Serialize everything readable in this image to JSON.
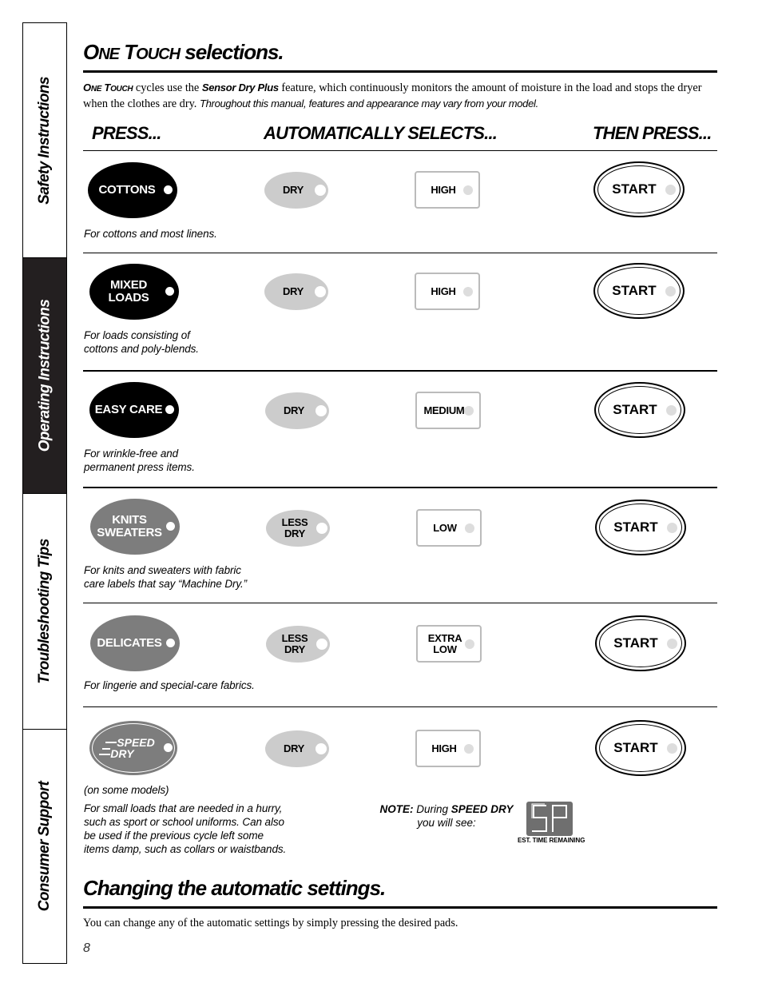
{
  "side_tabs": [
    {
      "label": "Safety Instructions",
      "active": false
    },
    {
      "label": "Operating Instructions",
      "active": true
    },
    {
      "label": "Troubleshooting Tips",
      "active": false
    },
    {
      "label": "Consumer Support",
      "active": false
    }
  ],
  "section1": {
    "title_first": "O",
    "title_first_small": "NE",
    "title_second": " T",
    "title_second_small": "OUCH",
    "title_rest": " selections.",
    "intro": {
      "brand_first": "O",
      "brand_first_small": "NE",
      "brand_second": " T",
      "brand_second_small": "OUCH",
      "text1": " cycles use the ",
      "feature": "Sensor Dry Plus",
      "text2": " feature, which continuously monitors the amount of moisture in the load and stops the dryer when the clothes are dry. ",
      "disclaimer": "Throughout this manual, features and appearance may vary from your model."
    }
  },
  "columns": {
    "press": "PRESS...",
    "auto_selects": "AUTOMATICALLY SELECTS...",
    "then_press": "THEN PRESS..."
  },
  "cycles": [
    {
      "cycle_line1": "COTTONS",
      "cycle_line2": "",
      "cycle_style": "black",
      "dryness": "DRY",
      "dryness_line2": "",
      "heat": "HIGH",
      "heat_line2": "",
      "start": "START",
      "description": [
        "For cottons and most linens."
      ]
    },
    {
      "cycle_line1": "MIXED",
      "cycle_line2": "LOADS",
      "cycle_style": "black",
      "dryness": "DRY",
      "dryness_line2": "",
      "heat": "HIGH",
      "heat_line2": "",
      "start": "START",
      "description": [
        "For loads consisting of",
        "cottons and poly-blends."
      ]
    },
    {
      "cycle_line1": "EASY CARE",
      "cycle_line2": "",
      "cycle_style": "black",
      "dryness": "DRY",
      "dryness_line2": "",
      "heat": "MEDIUM",
      "heat_line2": "",
      "start": "START",
      "description": [
        "For wrinkle-free and",
        "permanent press items."
      ]
    },
    {
      "cycle_line1": "KNITS",
      "cycle_line2": "SWEATERS",
      "cycle_style": "grey",
      "dryness": "LESS",
      "dryness_line2": "DRY",
      "heat": "LOW",
      "heat_line2": "",
      "start": "START",
      "description": [
        "For knits and sweaters with fabric",
        "care labels that say “Machine Dry.”"
      ]
    },
    {
      "cycle_line1": "DELICATES",
      "cycle_line2": "",
      "cycle_style": "grey",
      "dryness": "LESS",
      "dryness_line2": "DRY",
      "heat": "EXTRA",
      "heat_line2": "LOW",
      "start": "START",
      "description": [
        "For lingerie and special-care fabrics."
      ]
    },
    {
      "cycle_line1": "SPEED",
      "cycle_line2": "DRY",
      "cycle_style": "speed",
      "dryness": "DRY",
      "dryness_line2": "",
      "heat": "HIGH",
      "heat_line2": "",
      "start": "START",
      "availability": "(on some models)",
      "description": [
        "For small loads that are needed in a hurry,",
        "such as sport or school uniforms. Can also",
        "be used if the previous cycle left some",
        "items damp, such as collars or waistbands."
      ]
    }
  ],
  "speed_dry_note": {
    "note_label": "NOTE:",
    "text1": " During ",
    "cycle": "SPEED DRY",
    "text2": "you will see:",
    "display_value": "SP",
    "display_caption": "EST. TIME REMAINING"
  },
  "section2": {
    "title": "Changing the automatic settings.",
    "body": "You can change any of the automatic settings by simply pressing the desired pads."
  },
  "page_number": "8",
  "colors": {
    "tab_active_bg": "#231f20",
    "cycle_black": "#000000",
    "cycle_grey": "#7d7d7d",
    "dry_pad": "#cccccc",
    "heat_border": "#bbbbbb",
    "indicator_off": "#dddddd",
    "display_bg": "#6f6f6f"
  }
}
